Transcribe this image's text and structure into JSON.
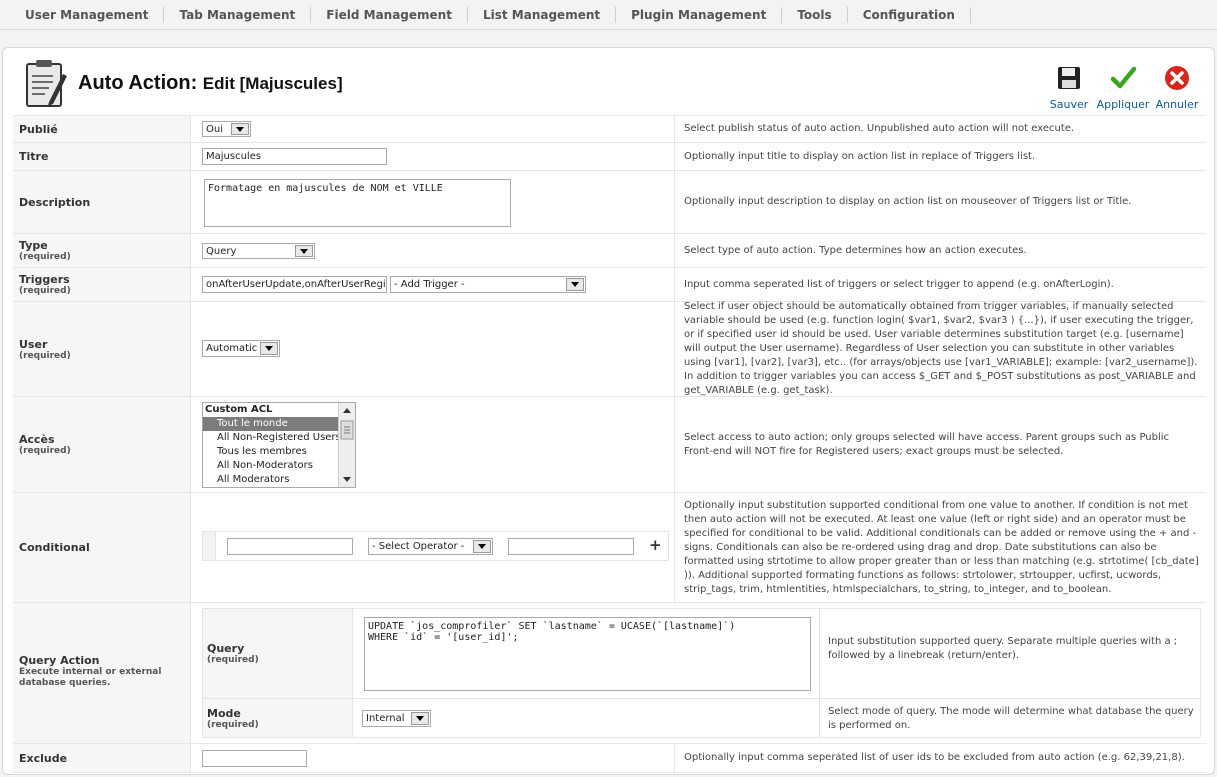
{
  "menu": [
    "User Management",
    "Tab Management",
    "Field Management",
    "List Management",
    "Plugin Management",
    "Tools",
    "Configuration"
  ],
  "header": {
    "title": "Auto Action:",
    "subtitle": "Edit [Majuscules]"
  },
  "toolbar": {
    "save": "Sauver",
    "apply": "Appliquer",
    "cancel": "Annuler"
  },
  "required": "(required)",
  "fields": {
    "published": {
      "label": "Publié",
      "value": "Oui",
      "desc": "Select publish status of auto action. Unpublished auto action will not execute."
    },
    "title": {
      "label": "Titre",
      "value": "Majuscules",
      "desc": "Optionally input title to display on action list in replace of Triggers list."
    },
    "description": {
      "label": "Description",
      "value": "Formatage en majuscules de NOM et VILLE",
      "desc": "Optionally input description to display on action list on mouseover of Triggers list or Title."
    },
    "type": {
      "label": "Type",
      "value": "Query",
      "desc": "Select type of auto action. Type determines how an action executes."
    },
    "triggers": {
      "label": "Triggers",
      "value": "onAfterUserUpdate,onAfterUserRegistra",
      "add": "- Add Trigger -",
      "desc": "Input comma seperated list of triggers or select trigger to append (e.g. onAfterLogin)."
    },
    "user": {
      "label": "User",
      "value": "Automatic",
      "desc": "Select if user object should be automatically obtained from trigger variables, if manually selected variable should be used (e.g. function login( $var1, $var2, $var3 ) {...}), if user executing the trigger, or if specified user id should be used. User variable determines substitution target (e.g. [username] will output the User username). Regardless of User selection you can substitute in other variables using [var1], [var2], [var3], etc.. (for arrays/objects use [var1_VARIABLE]; example: [var2_username]). In addition to trigger variables you can access $_GET and $_POST substitutions as post_VARIABLE and get_VARIABLE (e.g. get_task)."
    },
    "access": {
      "label": "Accès",
      "options": [
        "Custom ACL",
        "Tout le monde",
        "All Non-Registered Users",
        "Tous les membres",
        "All Non-Moderators",
        "All Moderators"
      ],
      "selected": "Tout le monde",
      "desc": "Select access to auto action; only groups selected will have access. Parent groups such as Public Front-end will NOT fire for Registered users; exact groups must be selected."
    },
    "conditional": {
      "label": "Conditional",
      "left": "",
      "operator": "- Select Operator -",
      "right": "",
      "add": "+",
      "desc": "Optionally input substitution supported conditional from one value to another. If condition is not met then auto action will not be executed. At least one value (left or right side) and an operator must be specified for conditional to be valid. Additional conditionals can be added or remove using the + and - signs. Conditionals can also be re-ordered using drag and drop. Date substitutions can also be formatted using strtotime to allow proper greater than or less than matching (e.g. strtotime( [cb_date] )). Additional supported formating functions as follows: strtolower, strtoupper, ucfirst, ucwords, strip_tags, trim, htmlentities, htmlspecialchars, to_string, to_integer, and to_boolean."
    },
    "query_action": {
      "label": "Query Action",
      "note": "Execute internal or external database queries.",
      "query": {
        "label": "Query",
        "value": "UPDATE `jos_comprofiler` SET `lastname` = UCASE(`[lastname]`)\nWHERE `id` = '[user_id]';",
        "desc": "Input substitution supported query. Separate multiple queries with a ; followed by a linebreak (return/enter)."
      },
      "mode": {
        "label": "Mode",
        "value": "Internal",
        "desc": "Select mode of query. The mode will determine what database the query is performed on."
      }
    },
    "exclude": {
      "label": "Exclude",
      "value": "",
      "desc": "Optionally input comma seperated list of user ids to be excluded from auto action (e.g. 62,39,21,8)."
    }
  }
}
